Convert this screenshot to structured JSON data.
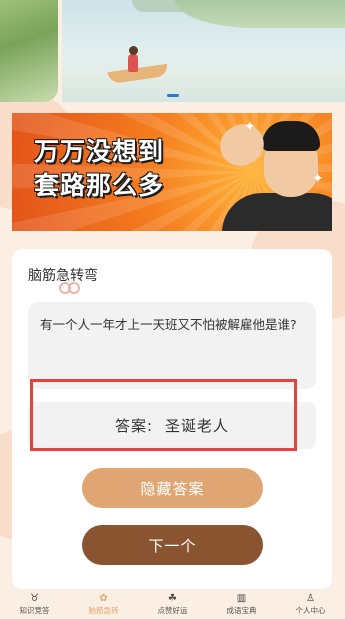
{
  "carousel": {
    "slide_count": 3,
    "active_index": 1
  },
  "poster": {
    "title": "万万没想到\n套路那么多"
  },
  "card": {
    "section_title": "脑筋急转弯",
    "question": "有一个人一年才上一天班又不怕被解雇他是谁?",
    "answer_label": "答案:",
    "answer_value": "圣诞老人",
    "hide_answer_label": "隐藏答案",
    "next_label": "下一个"
  },
  "tabbar": {
    "items": [
      {
        "label": "知识竞答",
        "icon": "trophy-icon",
        "glyph": "♉"
      },
      {
        "label": "脑筋急转",
        "icon": "brain-icon",
        "glyph": "✿"
      },
      {
        "label": "点赞好运",
        "icon": "clover-icon",
        "glyph": "☘"
      },
      {
        "label": "成语宝典",
        "icon": "book-icon",
        "glyph": "▥"
      },
      {
        "label": "个人中心",
        "icon": "user-icon",
        "glyph": "♙"
      }
    ],
    "active_index": 1,
    "active_color": "#e2a86e"
  },
  "colors": {
    "background": "#fbeee3",
    "hide_button": "#dfa572",
    "next_button": "#8a5430",
    "highlight_border": "#e8403e",
    "poster_orange": "#f47b1e"
  }
}
